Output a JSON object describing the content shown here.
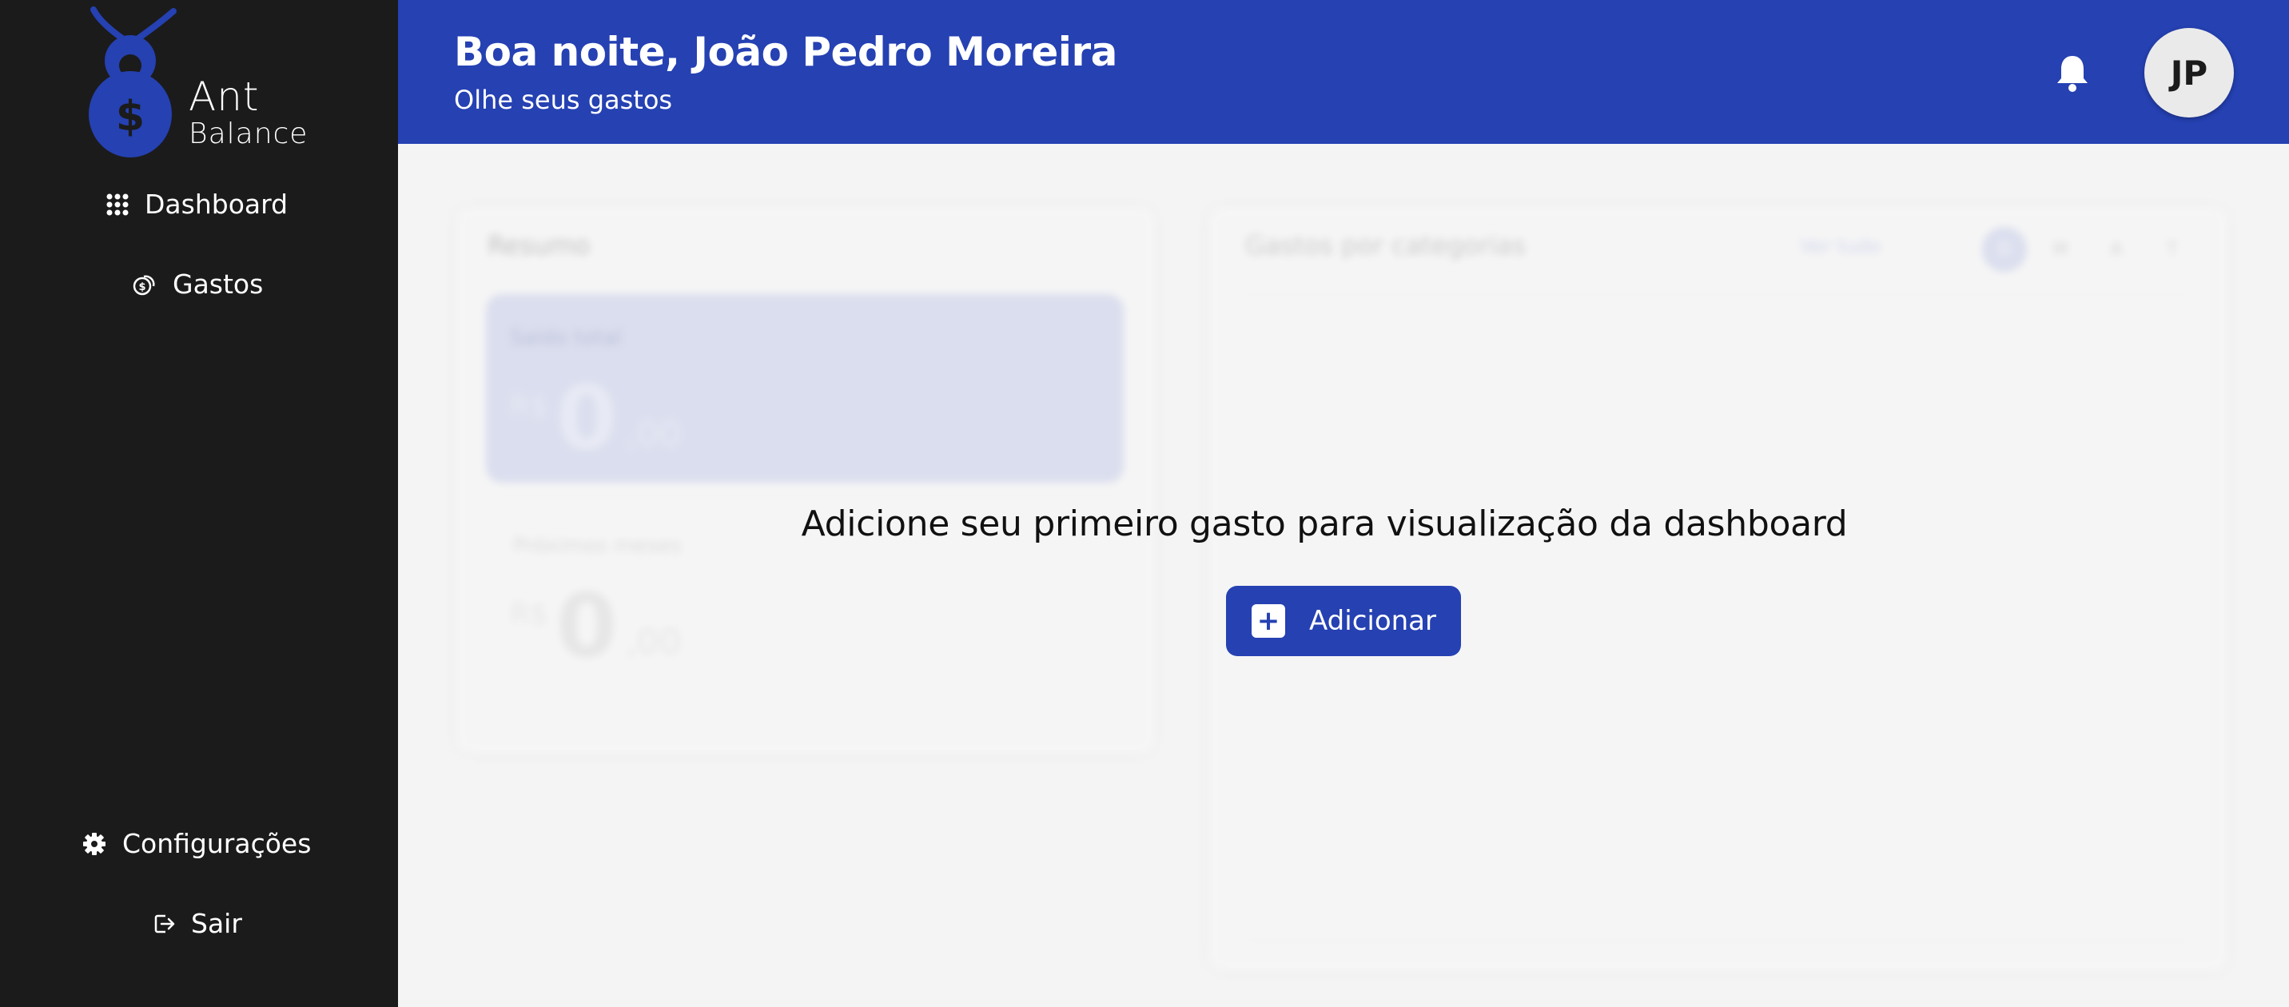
{
  "brand": {
    "line1": "Ant",
    "line2": "Balance",
    "accent": "#2541b2"
  },
  "sidebar": {
    "items": [
      {
        "label": "Dashboard",
        "icon": "grid-icon"
      },
      {
        "label": "Gastos",
        "icon": "coins-icon"
      }
    ],
    "bottom": [
      {
        "label": "Configurações",
        "icon": "gear-icon"
      },
      {
        "label": "Sair",
        "icon": "logout-icon"
      }
    ]
  },
  "header": {
    "greeting": "Boa noite, João Pedro Moreira",
    "subtitle": "Olhe seus gastos",
    "avatar_initials": "JP"
  },
  "resumo": {
    "title": "Resumo",
    "saldo_label": "Saldo total",
    "saldo": {
      "currency": "R$",
      "int": "0",
      "dec": ",00"
    },
    "proximo_label": "Próximos meses",
    "proximo": {
      "currency": "R$",
      "int": "0",
      "dec": ",00"
    }
  },
  "gastos_card": {
    "title": "Gastos por categorias",
    "link": "Ver tudo",
    "periods": [
      "D",
      "M",
      "A",
      "T"
    ]
  },
  "empty_state": {
    "message": "Adicione seu primeiro gasto para visualização da dashboard",
    "button_label": "Adicionar"
  }
}
